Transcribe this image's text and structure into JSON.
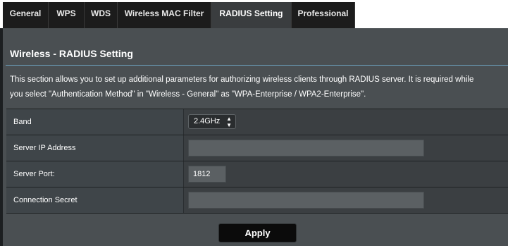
{
  "tabs": [
    {
      "label": "General"
    },
    {
      "label": "WPS"
    },
    {
      "label": "WDS"
    },
    {
      "label": "Wireless MAC Filter"
    },
    {
      "label": "RADIUS Setting"
    },
    {
      "label": "Professional"
    }
  ],
  "active_tab": "RADIUS Setting",
  "page": {
    "title": "Wireless - RADIUS Setting",
    "description_line1": "This section allows you to set up additional parameters for authorizing wireless clients through RADIUS server. It is required while",
    "description_line2": "you select \"Authentication Method\" in \"Wireless - General\" as \"WPA-Enterprise / WPA2-Enterprise\"."
  },
  "form": {
    "band": {
      "label": "Band",
      "selected": "2.4GHz"
    },
    "server_ip": {
      "label": "Server IP Address",
      "value": ""
    },
    "server_port": {
      "label": "Server Port:",
      "value": "1812"
    },
    "connection_secret": {
      "label": "Connection Secret",
      "value": ""
    }
  },
  "apply_label": "Apply",
  "colors": {
    "background": "#4a4f52",
    "accent_divider": "#6fa6c4",
    "tab_bar": "#1c1c1c",
    "button": "#0b0b0b"
  }
}
